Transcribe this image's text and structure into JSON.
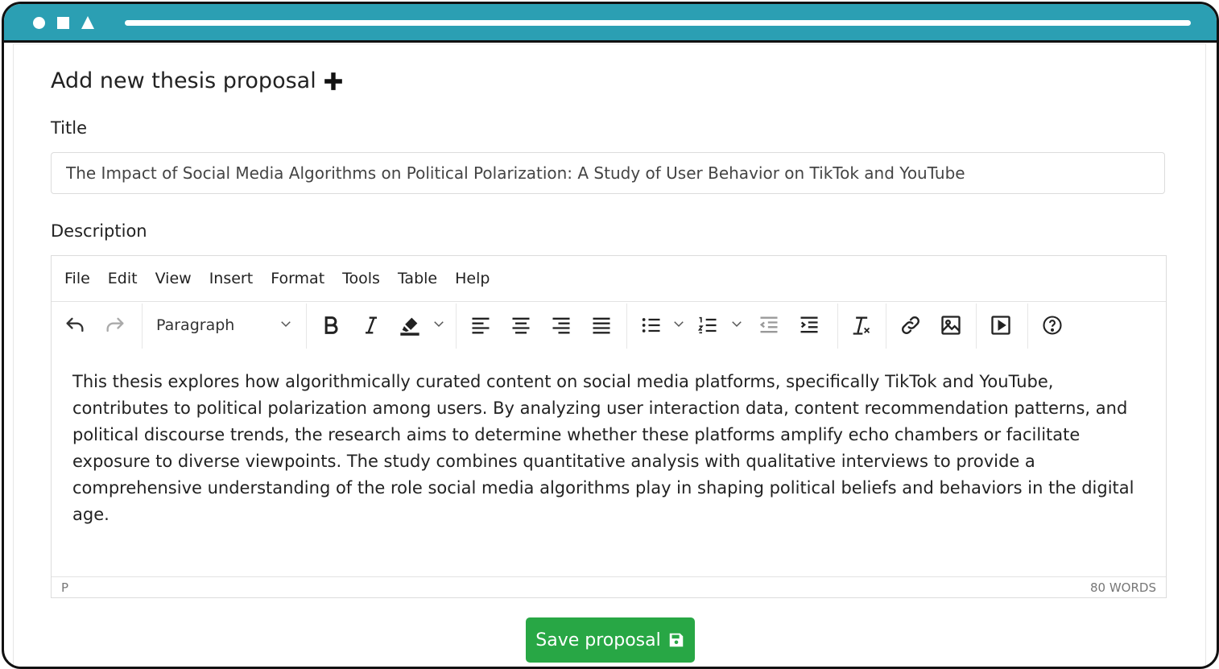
{
  "colors": {
    "titlebar": "#2b9fb3",
    "save_button": "#28a745"
  },
  "form": {
    "heading": "Add new thesis proposal",
    "title_label": "Title",
    "title_value": "The Impact of Social Media Algorithms on Political Polarization: A Study of User Behavior on TikTok and YouTube",
    "description_label": "Description"
  },
  "editor": {
    "menu": [
      "File",
      "Edit",
      "View",
      "Insert",
      "Format",
      "Tools",
      "Table",
      "Help"
    ],
    "block_format": "Paragraph",
    "content": "This thesis explores how algorithmically curated content on social media platforms, specifically TikTok and YouTube, contributes to political polarization among users. By analyzing user interaction data, content recommendation patterns, and political discourse trends, the research aims to determine whether these platforms amplify echo chambers or facilitate exposure to diverse viewpoints. The study combines quantitative analysis with qualitative interviews to provide a comprehensive understanding of the role social media algorithms play in shaping political beliefs and behaviors in the digital age.",
    "status_element": "P",
    "word_count": "80 WORDS"
  },
  "actions": {
    "save_label": "Save proposal"
  }
}
